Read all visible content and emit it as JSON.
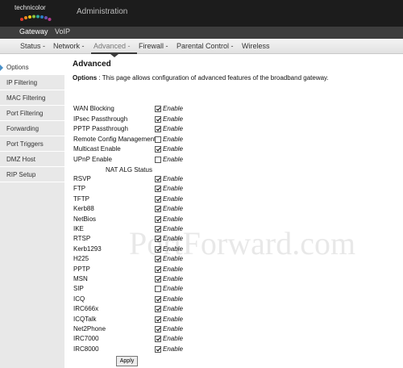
{
  "brand": {
    "logo_text": "technicolor"
  },
  "header": {
    "title": "Administration"
  },
  "subtabs": [
    {
      "label": "Gateway",
      "active": true
    },
    {
      "label": "VoIP",
      "active": false
    }
  ],
  "nav": [
    {
      "label": "Status -"
    },
    {
      "label": "Network -"
    },
    {
      "label": "Advanced -"
    },
    {
      "label": "Firewall -"
    },
    {
      "label": "Parental Control -"
    },
    {
      "label": "Wireless"
    }
  ],
  "sidebar": {
    "items": [
      {
        "label": "Options"
      },
      {
        "label": "IP Filtering"
      },
      {
        "label": "MAC Filtering"
      },
      {
        "label": "Port Filtering"
      },
      {
        "label": "Forwarding"
      },
      {
        "label": "Port Triggers"
      },
      {
        "label": "DMZ Host"
      },
      {
        "label": "RIP Setup"
      }
    ]
  },
  "main": {
    "title": "Advanced",
    "desc_label": "Options",
    "desc_text": ":  This page allows configuration of advanced features of the broadband gateway.",
    "nat_header": "NAT ALG Status",
    "enable_text": "Enable",
    "apply_label": "Apply",
    "options": [
      {
        "label": "WAN Blocking",
        "checked": true
      },
      {
        "label": "IPsec Passthrough",
        "checked": true
      },
      {
        "label": "PPTP Passthrough",
        "checked": true
      },
      {
        "label": "Remote Config Management",
        "checked": false
      },
      {
        "label": "Multicast Enable",
        "checked": true
      },
      {
        "label": "UPnP Enable",
        "checked": false
      }
    ],
    "nat": [
      {
        "label": "RSVP",
        "checked": true
      },
      {
        "label": "FTP",
        "checked": true
      },
      {
        "label": "TFTP",
        "checked": true
      },
      {
        "label": "Kerb88",
        "checked": true
      },
      {
        "label": "NetBios",
        "checked": true
      },
      {
        "label": "IKE",
        "checked": true
      },
      {
        "label": "RTSP",
        "checked": true
      },
      {
        "label": "Kerb1293",
        "checked": true
      },
      {
        "label": "H225",
        "checked": true
      },
      {
        "label": "PPTP",
        "checked": true
      },
      {
        "label": "MSN",
        "checked": true
      },
      {
        "label": "SIP",
        "checked": false
      },
      {
        "label": "ICQ",
        "checked": true
      },
      {
        "label": "IRC666x",
        "checked": true
      },
      {
        "label": "ICQTalk",
        "checked": true
      },
      {
        "label": "Net2Phone",
        "checked": true
      },
      {
        "label": "IRC7000",
        "checked": true
      },
      {
        "label": "IRC8000",
        "checked": true
      }
    ]
  },
  "watermark": "PortForward.com"
}
